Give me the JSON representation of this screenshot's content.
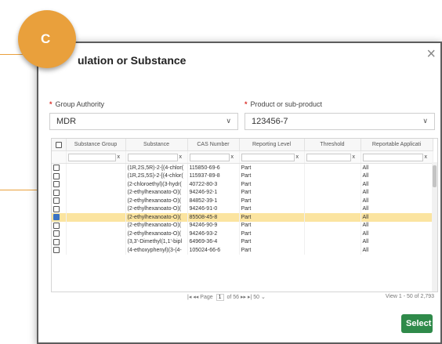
{
  "badge": {
    "letter": "C",
    "color": "#e9a03c"
  },
  "dialog": {
    "title": "ulation or Substance",
    "close_glyph": "×"
  },
  "fields": {
    "group_authority": {
      "label": "Group Authority",
      "value": "MDR"
    },
    "product": {
      "label": "Product or sub-product",
      "value": "123456-7"
    }
  },
  "grid": {
    "headers": [
      "Substance Group",
      "Substance",
      "CAS Number",
      "Reporting Level",
      "Threshold",
      "Reportable Applicati"
    ],
    "filter_clear": "x",
    "rows": [
      {
        "substance": "(1R,2S,5R)-2-[(4-chlor(",
        "cas": "115850-69-6",
        "level": "Part",
        "app": "All",
        "checked": false,
        "selected": false
      },
      {
        "substance": "(1R,2S,5S)-2-[(4-chlor(",
        "cas": "115937-89-8",
        "level": "Part",
        "app": "All",
        "checked": false,
        "selected": false
      },
      {
        "substance": "(2-chloroethyl)(3-hydr(",
        "cas": "40722-80-3",
        "level": "Part",
        "app": "All",
        "checked": false,
        "selected": false
      },
      {
        "substance": "(2-ethylhexanoato-O)(",
        "cas": "94246-92-1",
        "level": "Part",
        "app": "All",
        "checked": false,
        "selected": false
      },
      {
        "substance": "(2-ethylhexanoato-O)(",
        "cas": "84852-39-1",
        "level": "Part",
        "app": "All",
        "checked": false,
        "selected": false
      },
      {
        "substance": "(2-ethylhexanoato-O)(",
        "cas": "94246-91-0",
        "level": "Part",
        "app": "All",
        "checked": false,
        "selected": false
      },
      {
        "substance": "(2-ethylhexanoato-O)(",
        "cas": "85508-45-8",
        "level": "Part",
        "app": "All",
        "checked": true,
        "selected": true
      },
      {
        "substance": "(2-ethylhexanoato-O)(",
        "cas": "94246-90-9",
        "level": "Part",
        "app": "All",
        "checked": false,
        "selected": false
      },
      {
        "substance": "(2-ethylhexanoato-O)(",
        "cas": "94246-93-2",
        "level": "Part",
        "app": "All",
        "checked": false,
        "selected": false
      },
      {
        "substance": "(3,3'-Dimethyl(1,1'-bipl",
        "cas": "64969-36-4",
        "level": "Part",
        "app": "All",
        "checked": false,
        "selected": false
      },
      {
        "substance": "(4-ethoxyphenyl)(3-(4-",
        "cas": "105024-66-6",
        "level": "Part",
        "app": "All",
        "checked": false,
        "selected": false
      }
    ]
  },
  "pager": {
    "first": "|◂",
    "prev": "◂◂",
    "page_label": "Page",
    "page": "1",
    "of_label": "of 56",
    "next": "▸▸",
    "last": "▸|",
    "page_size": "50",
    "range": "View 1 - 50 of 2,793"
  },
  "actions": {
    "select_label": "Select",
    "color": "#2f8a4a"
  },
  "colors": {
    "selected_row": "#fbe4a0",
    "required": "#d9302b",
    "checkbox_on": "#3a73c4"
  }
}
